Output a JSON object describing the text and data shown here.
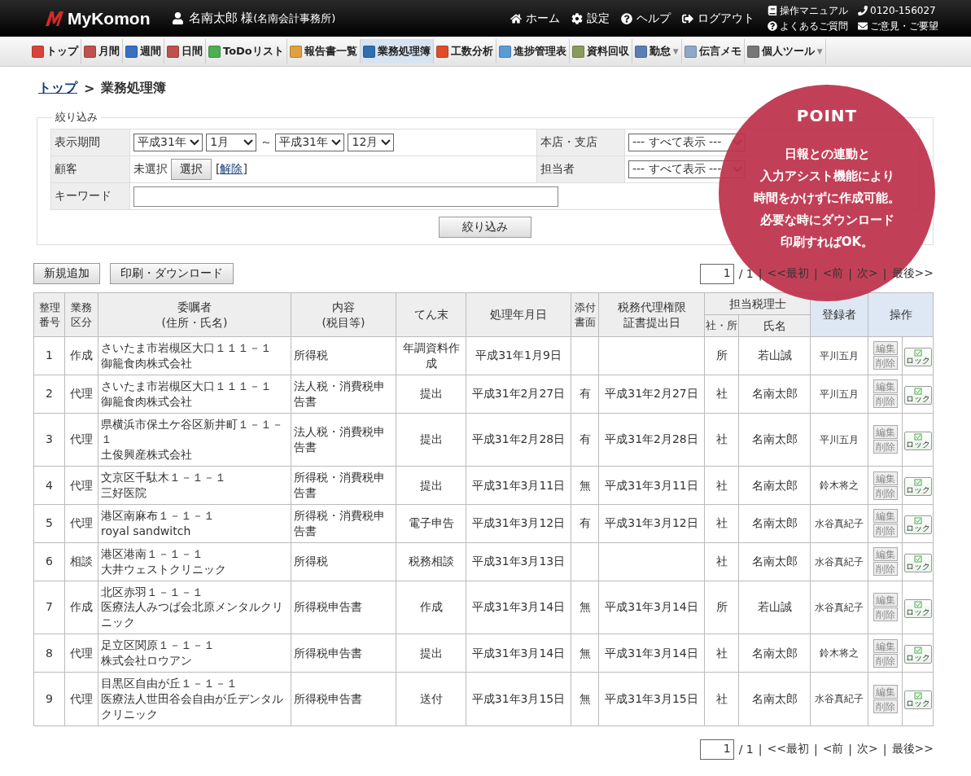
{
  "header": {
    "logo": "MyKomon",
    "user": "名南太郎 様",
    "office": "(名南会計事務所)",
    "nav": [
      {
        "kind": "home",
        "label": "ホーム"
      },
      {
        "kind": "settings",
        "label": "設定"
      },
      {
        "kind": "help",
        "label": "ヘルプ"
      },
      {
        "kind": "logout",
        "label": "ログアウト"
      }
    ],
    "links": [
      {
        "kind": "manual",
        "label": "操作マニュアル"
      },
      {
        "kind": "phone",
        "label": "0120-156027"
      },
      {
        "kind": "faq",
        "label": "よくあるご質問"
      },
      {
        "kind": "mail",
        "label": "ご意見・ご要望"
      }
    ]
  },
  "toolbar": [
    {
      "label": "トップ",
      "color": "#d9443a",
      "selected": false
    },
    {
      "label": "月間",
      "color": "#c0504d",
      "selected": false
    },
    {
      "label": "週間",
      "color": "#3a6fc4",
      "selected": false
    },
    {
      "label": "日間",
      "color": "#c0504d",
      "selected": false
    },
    {
      "label": "ToDoリスト",
      "color": "#4caf50",
      "selected": false
    },
    {
      "label": "報告書一覧",
      "color": "#e0a040",
      "selected": false
    },
    {
      "label": "業務処理簿",
      "color": "#2f6fb0",
      "selected": true
    },
    {
      "label": "工数分析",
      "color": "#e04b2a",
      "selected": false
    },
    {
      "label": "進捗管理表",
      "color": "#5a9bd5",
      "selected": false
    },
    {
      "label": "資料回収",
      "color": "#8a9a5b",
      "selected": false
    },
    {
      "label": "勤怠",
      "color": "#5b7fb5",
      "menu_caret": "▼",
      "selected": false
    },
    {
      "label": "伝言メモ",
      "color": "#8fa8c8",
      "selected": false
    },
    {
      "label": "個人ツール",
      "color": "#777777",
      "menu_caret": "▼",
      "selected": false
    }
  ],
  "breadcrumb": {
    "link": "トップ",
    "sep": ">",
    "current": "業務処理簿"
  },
  "filter": {
    "legend": "絞り込み",
    "period_label": "表示期間",
    "period_from_year": "平成31年",
    "period_from_month": "1月",
    "tilde": "～",
    "period_to_year": "平成31年",
    "period_to_month": "12月",
    "branch_label": "本店・支店",
    "branch_value": "--- すべて表示 ---",
    "client_label": "顧客",
    "client_value": "未選択",
    "select_button": "選択",
    "bracket_open": "[",
    "clear_link": "解除",
    "bracket_close": "]",
    "staff_label": "担当者",
    "staff_value": "--- すべて表示 ---",
    "keyword_label": "キーワード",
    "submit": "絞り込み"
  },
  "actions": [
    "新規追加",
    "印刷・ダウンロード"
  ],
  "pager_top": {
    "page": "1",
    "total": "/ 1",
    "sep": "|",
    "first": "<<最初",
    "prev": "<前",
    "next": "次>",
    "last": "最後>>"
  },
  "table": {
    "columns": [
      [
        "整理",
        "番号"
      ],
      [
        "業務",
        "区分"
      ],
      [
        "委嘱者",
        "(住所・氏名)"
      ],
      [
        "内容",
        "(税目等)"
      ],
      [
        "てん末"
      ],
      [
        "処理年月日"
      ],
      [
        "添付",
        "書面"
      ],
      [
        "税務代理権限",
        "証書提出日"
      ],
      [
        "担当税理士"
      ],
      [
        "登録者"
      ],
      [
        "操作"
      ]
    ],
    "subcolumns": [
      "社・所",
      "氏名"
    ],
    "rows": [
      {
        "no": "1",
        "type": "作成",
        "address": "さいたま市岩槻区大口１１１－１",
        "name": "御籠食肉株式会社",
        "content": "所得税",
        "status": "年調資料作成",
        "date": "平成31年1月9日",
        "attached": "",
        "cert_date": "",
        "office": "所",
        "accountant": "若山誠",
        "registrant": "平川五月",
        "edit": "編集",
        "delete": "削除",
        "lock": "ロック"
      },
      {
        "no": "2",
        "type": "代理",
        "address": "さいたま市岩槻区大口１１１－１",
        "name": "御籠食肉株式会社",
        "content": "法人税・消費税申告書",
        "status": "提出",
        "date": "平成31年2月27日",
        "attached": "有",
        "cert_date": "平成31年2月27日",
        "office": "社",
        "accountant": "名南太郎",
        "registrant": "平川五月",
        "edit": "編集",
        "delete": "削除",
        "lock": "ロック"
      },
      {
        "no": "3",
        "type": "代理",
        "address": "県横浜市保土ケ谷区新井町１－１－１",
        "name": "土俊興産株式会社",
        "content": "法人税・消費税申告書",
        "status": "提出",
        "date": "平成31年2月28日",
        "attached": "有",
        "cert_date": "平成31年2月28日",
        "office": "社",
        "accountant": "名南太郎",
        "registrant": "平川五月",
        "edit": "編集",
        "delete": "削除",
        "lock": "ロック"
      },
      {
        "no": "4",
        "type": "代理",
        "address": "文京区千駄木１－１－１",
        "name": "三好医院",
        "content": "所得税・消費税申告書",
        "status": "提出",
        "date": "平成31年3月11日",
        "attached": "無",
        "cert_date": "平成31年3月11日",
        "office": "社",
        "accountant": "名南太郎",
        "registrant": "鈴木将之",
        "edit": "編集",
        "delete": "削除",
        "lock": "ロック"
      },
      {
        "no": "5",
        "type": "代理",
        "address": "港区南麻布１－１－１",
        "name": "royal sandwitch",
        "content": "所得税・消費税申告書",
        "status": "電子申告",
        "date": "平成31年3月12日",
        "attached": "有",
        "cert_date": "平成31年3月12日",
        "office": "社",
        "accountant": "名南太郎",
        "registrant": "水谷真紀子",
        "edit": "編集",
        "delete": "削除",
        "lock": "ロック"
      },
      {
        "no": "6",
        "type": "相談",
        "address": "港区港南１－１－１",
        "name": "大井ウェストクリニック",
        "content": "所得税",
        "status": "税務相談",
        "date": "平成31年3月13日",
        "attached": "",
        "cert_date": "",
        "office": "社",
        "accountant": "名南太郎",
        "registrant": "水谷真紀子",
        "edit": "編集",
        "delete": "削除",
        "lock": "ロック"
      },
      {
        "no": "7",
        "type": "作成",
        "address": "北区赤羽１－１－１",
        "name": "医療法人みつば会北原メンタルクリニック",
        "content": "所得税申告書",
        "status": "作成",
        "date": "平成31年3月14日",
        "attached": "無",
        "cert_date": "平成31年3月14日",
        "office": "所",
        "accountant": "若山誠",
        "registrant": "水谷真紀子",
        "edit": "編集",
        "delete": "削除",
        "lock": "ロック"
      },
      {
        "no": "8",
        "type": "代理",
        "address": "足立区関原１－１－１",
        "name": "株式会社ロウアン",
        "content": "所得税申告書",
        "status": "提出",
        "date": "平成31年3月14日",
        "attached": "無",
        "cert_date": "平成31年3月14日",
        "office": "社",
        "accountant": "名南太郎",
        "registrant": "鈴木将之",
        "edit": "編集",
        "delete": "削除",
        "lock": "ロック"
      },
      {
        "no": "9",
        "type": "代理",
        "address": "目黒区自由が丘１－１－１",
        "name": "医療法人世田谷会自由が丘デンタルクリニック",
        "content": "所得税申告書",
        "status": "送付",
        "date": "平成31年3月15日",
        "attached": "無",
        "cert_date": "平成31年3月15日",
        "office": "社",
        "accountant": "名南太郎",
        "registrant": "水谷真紀子",
        "edit": "編集",
        "delete": "削除",
        "lock": "ロック"
      }
    ]
  },
  "pager_bottom": {
    "page": "1",
    "total": "/ 1",
    "sep": "|",
    "first": "<<最初",
    "prev": "<前",
    "next": "次>",
    "last": "最後>>"
  },
  "point": {
    "title": "POINT",
    "lines": [
      "日報との連動と",
      "入力アシスト機能により",
      "時間をかけずに作成可能。",
      "必要な時にダウンロード",
      "印刷すればOK。"
    ]
  }
}
